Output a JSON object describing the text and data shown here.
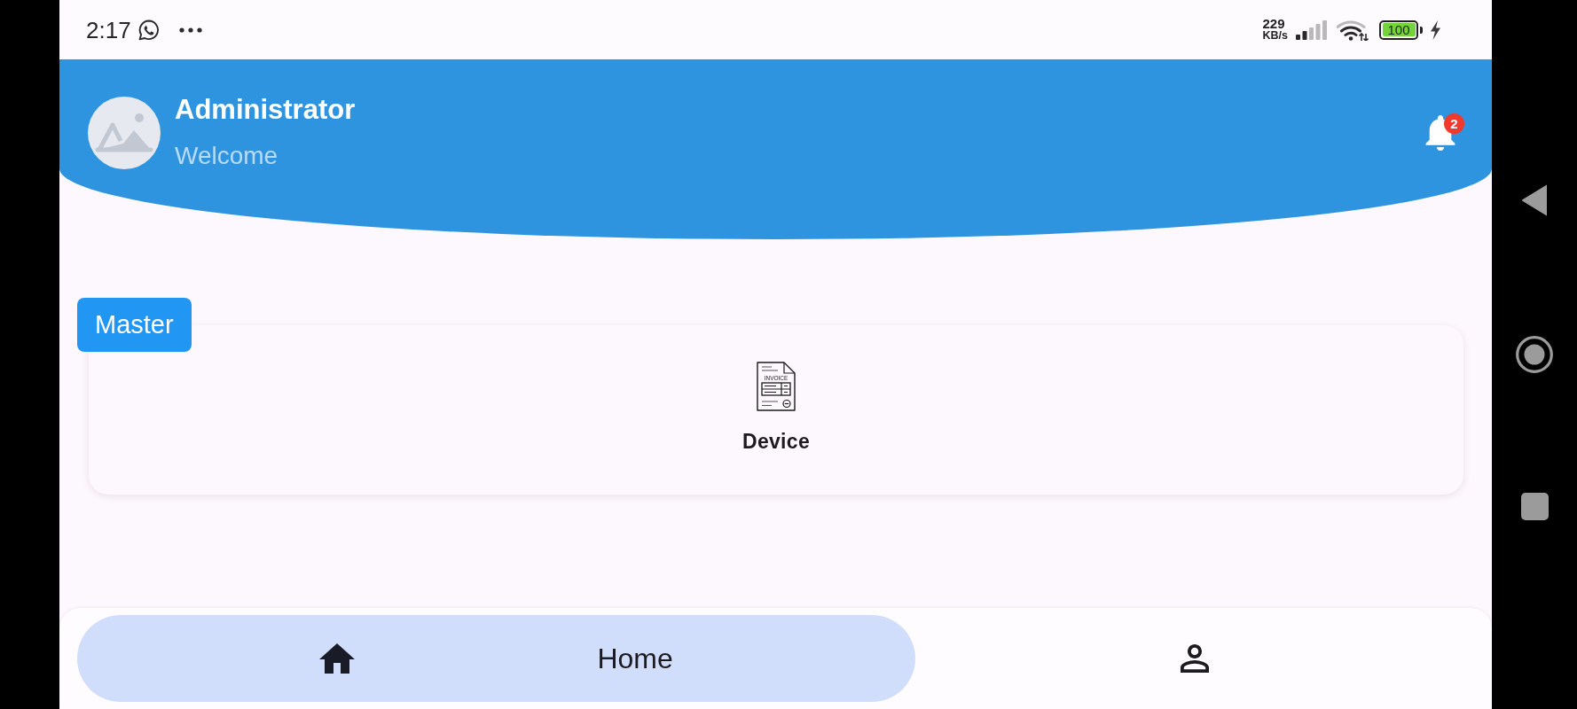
{
  "status_bar": {
    "time": "2:17",
    "network_speed": "229",
    "network_unit": "KB/s",
    "battery": "100"
  },
  "header": {
    "title": "Administrator",
    "subtitle": "Welcome",
    "notification_count": "2"
  },
  "sections": [
    {
      "label": "Master",
      "items": [
        {
          "label": "Device",
          "icon_text": "INVOICE"
        }
      ]
    }
  ],
  "bottom_nav": [
    {
      "label": "Home",
      "selected": true
    },
    {
      "selected": false
    }
  ]
}
